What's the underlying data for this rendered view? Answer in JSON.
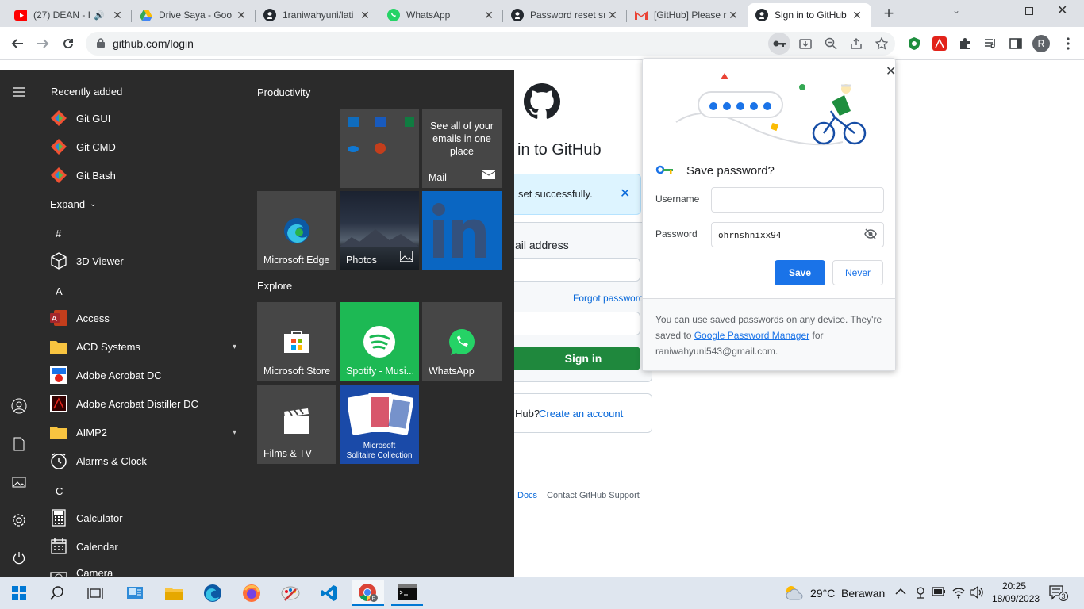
{
  "browser": {
    "tabs": [
      {
        "title": "(27) DEAN - I",
        "icon": "youtube-icon",
        "color": "#ff0000"
      },
      {
        "title": "Drive Saya - Goo",
        "icon": "google-drive-icon"
      },
      {
        "title": "1raniwahyuni/lati",
        "icon": "github-icon"
      },
      {
        "title": "WhatsApp",
        "icon": "whatsapp-icon",
        "color": "#25d366"
      },
      {
        "title": "Password reset sı",
        "icon": "github-icon"
      },
      {
        "title": "[GitHub] Please r",
        "icon": "gmail-icon"
      },
      {
        "title": "Sign in to GitHub",
        "icon": "github-icon",
        "active": true
      }
    ],
    "new_tab_symbol": "+",
    "url": "github.com/login",
    "profile_initial": "R"
  },
  "github": {
    "heading_partial": "in to GitHub",
    "flash_partial": "set successfully.",
    "email_label_partial": "ail address",
    "forgot_password": "Forgot password?",
    "sign_in_button": "Sign in",
    "new_to_partial": "Hub?",
    "create_account": "Create an account",
    "footer_docs": "Docs",
    "footer_support": "Contact GitHub Support"
  },
  "password_bubble": {
    "title": "Save password?",
    "username_label": "Username",
    "username_value": "",
    "password_label": "Password",
    "password_value": "ohrnshnixx94",
    "save_button": "Save",
    "never_button": "Never",
    "footer_text_1": "You can use saved passwords on any device. They're saved to",
    "footer_link": "Google Password Manager",
    "footer_text_2": "for",
    "footer_email": "raniwahyuni543@gmail.com."
  },
  "start_menu": {
    "recently_added_label": "Recently added",
    "recent": [
      "Git GUI",
      "Git CMD",
      "Git Bash"
    ],
    "expand_label": "Expand",
    "letters": {
      "hash": "#",
      "a": "A",
      "c": "C"
    },
    "apps": {
      "viewer": "3D Viewer",
      "access": "Access",
      "acd": "ACD Systems",
      "acrobat": "Adobe Acrobat DC",
      "distiller": "Adobe Acrobat Distiller DC",
      "aimp": "AIMP2",
      "alarms": "Alarms & Clock",
      "calculator": "Calculator",
      "calendar": "Calendar",
      "camera": "Camera"
    },
    "groups": {
      "productivity": "Productivity",
      "explore": "Explore"
    },
    "tiles": {
      "mail_text": "See all of your emails in one place",
      "mail": "Mail",
      "edge": "Microsoft Edge",
      "photos": "Photos",
      "store": "Microsoft Store",
      "spotify": "Spotify - Musi...",
      "whatsapp": "WhatsApp",
      "films": "Films & TV",
      "solitaire_1": "Microsoft",
      "solitaire_2": "Solitaire Collection"
    }
  },
  "taskbar": {
    "weather": "29°C  Berawan",
    "time": "20:25",
    "date": "18/09/2023",
    "notification_count": "3"
  },
  "colors": {
    "github_green": "#1f883d",
    "chrome_blue": "#1a73e8",
    "start_bg": "#2b2b2b",
    "linkedin": "#0a66c2",
    "spotify": "#1db954"
  }
}
